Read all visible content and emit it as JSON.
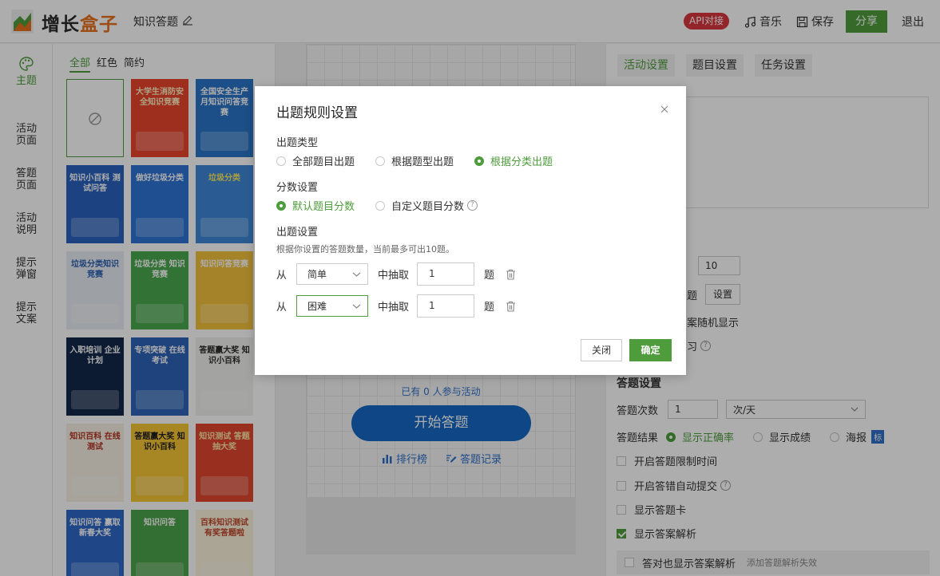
{
  "header": {
    "brand_a": "增长",
    "brand_b": "盒子",
    "app_title": "知识答题",
    "api_badge": "API对接",
    "music_label": "音乐",
    "save_label": "保存",
    "share_label": "分享",
    "exit_label": "退出"
  },
  "leftnav": {
    "items": [
      {
        "label": "主题"
      },
      {
        "label": "活动\n页面"
      },
      {
        "label": "答题\n页面"
      },
      {
        "label": "活动\n说明"
      },
      {
        "label": "提示\n弹窗"
      },
      {
        "label": "提示\n文案"
      }
    ]
  },
  "templates": {
    "tabs": [
      "全部",
      "红色",
      "简约"
    ],
    "cards": [
      {
        "title": "大学生消防安全知识竞赛",
        "bg": "#e9442c",
        "fg": "#fff3c6"
      },
      {
        "title": "全国安全生产月知识问答竞赛",
        "bg": "#2a74c7",
        "fg": "#ffffff"
      },
      {
        "title": "知识小百科 测试问答",
        "bg": "#2b62c0",
        "fg": "#ffffff"
      },
      {
        "title": "做好垃圾分类",
        "bg": "#2f74d6",
        "fg": "#ffffff"
      },
      {
        "title": "垃圾分类",
        "bg": "#3f88d9",
        "fg": "#ffe95a"
      },
      {
        "title": "垃圾分类知识竞赛",
        "bg": "#e8ecf3",
        "fg": "#2a5fb2"
      },
      {
        "title": "垃圾分类 知识竞赛",
        "bg": "#4aa84e",
        "fg": "#ffffff"
      },
      {
        "title": "知识问答竞赛",
        "bg": "#f4c23d",
        "fg": "#ffffff"
      },
      {
        "title": "入职培训 企业计划",
        "bg": "#13284b",
        "fg": "#ffffff"
      },
      {
        "title": "专项突破 在线考试",
        "bg": "#2e64b8",
        "fg": "#ffffff"
      },
      {
        "title": "答题赢大奖 知识小百科",
        "bg": "#f1f1ee",
        "fg": "#2a2a2a"
      },
      {
        "title": "知识百科 在线测试",
        "bg": "#f6efe3",
        "fg": "#b43321"
      },
      {
        "title": "答题赢大奖 知识小百科",
        "bg": "#f6c636",
        "fg": "#1f1f1f"
      },
      {
        "title": "知识测试 答题抽大奖",
        "bg": "#e0462f",
        "fg": "#ffe7a8"
      },
      {
        "title": "知识问答 赢取新春大奖",
        "bg": "#2e67c8",
        "fg": "#ffffff"
      },
      {
        "title": "知识问答",
        "bg": "#4ca24a",
        "fg": "#ffffff"
      },
      {
        "title": "百科知识测试 有奖答题啦",
        "bg": "#fbf3db",
        "fg": "#c2462c"
      }
    ]
  },
  "preview": {
    "participants": "已有 0 人参与活动",
    "start_button": "开始答题",
    "rank_link": "排行榜",
    "record_link": "答题记录"
  },
  "rightpanel": {
    "tabs": [
      "活动设置",
      "题目设置",
      "任务设置"
    ],
    "count_value": "10",
    "row_ti": "题",
    "setting_button": "设置",
    "random_text": "案随机显示",
    "partial_text": "习",
    "answer_settings_title": "答题设置",
    "attempts_label": "答题次数",
    "attempts_value": "1",
    "attempts_unit": "次/天",
    "result_label": "答题结果",
    "result_options": [
      "显示正确率",
      "显示成绩",
      "海报"
    ],
    "result_badge": "标",
    "checkbox_items": [
      {
        "label": "开启答题限制时间",
        "checked": false
      },
      {
        "label": "开启答错自动提交",
        "checked": false
      },
      {
        "label": "显示答题卡",
        "checked": false
      },
      {
        "label": "显示答案解析",
        "checked": true
      }
    ],
    "cut_text_a": "答对也显示答案解析",
    "cut_text_b": "添加答题解析失效"
  },
  "modal": {
    "title": "出题规则设置",
    "type_label": "出题类型",
    "type_options": [
      "全部题目出题",
      "根据题型出题",
      "根据分类出题"
    ],
    "type_selected": 2,
    "score_label": "分数设置",
    "score_options": [
      "默认题目分数",
      "自定义题目分数"
    ],
    "score_selected": 0,
    "rule_label": "出题设置",
    "hint": "根据你设置的答题数量，当前最多可出10题。",
    "rules": [
      {
        "from": "从",
        "category": "简单",
        "draw": "中抽取",
        "count": "1",
        "unit": "题"
      },
      {
        "from": "从",
        "category": "困难",
        "draw": "中抽取",
        "count": "1",
        "unit": "题"
      }
    ],
    "cancel_label": "关闭",
    "ok_label": "确定"
  },
  "colors": {
    "brand_green": "#4e9c3c",
    "api_red": "#d9363e",
    "start_blue": "#1768c4"
  }
}
